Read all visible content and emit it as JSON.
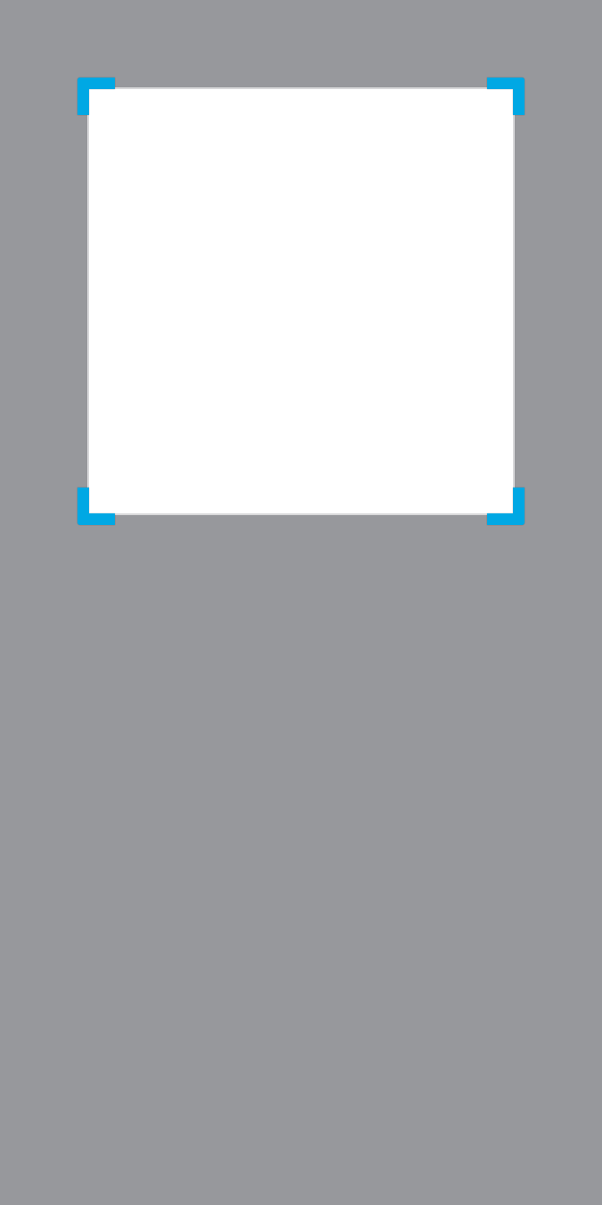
{
  "colors": {
    "background": "#97989c",
    "crop_area": "#ffffff",
    "crop_border": "#d8d8da",
    "handle_accent": "#00a8e4"
  },
  "crop": {
    "handles": [
      {
        "id": "top-left",
        "icon": "corner-handle-icon"
      },
      {
        "id": "top-right",
        "icon": "corner-handle-icon"
      },
      {
        "id": "bottom-left",
        "icon": "corner-handle-icon"
      },
      {
        "id": "bottom-right",
        "icon": "corner-handle-icon"
      }
    ]
  }
}
